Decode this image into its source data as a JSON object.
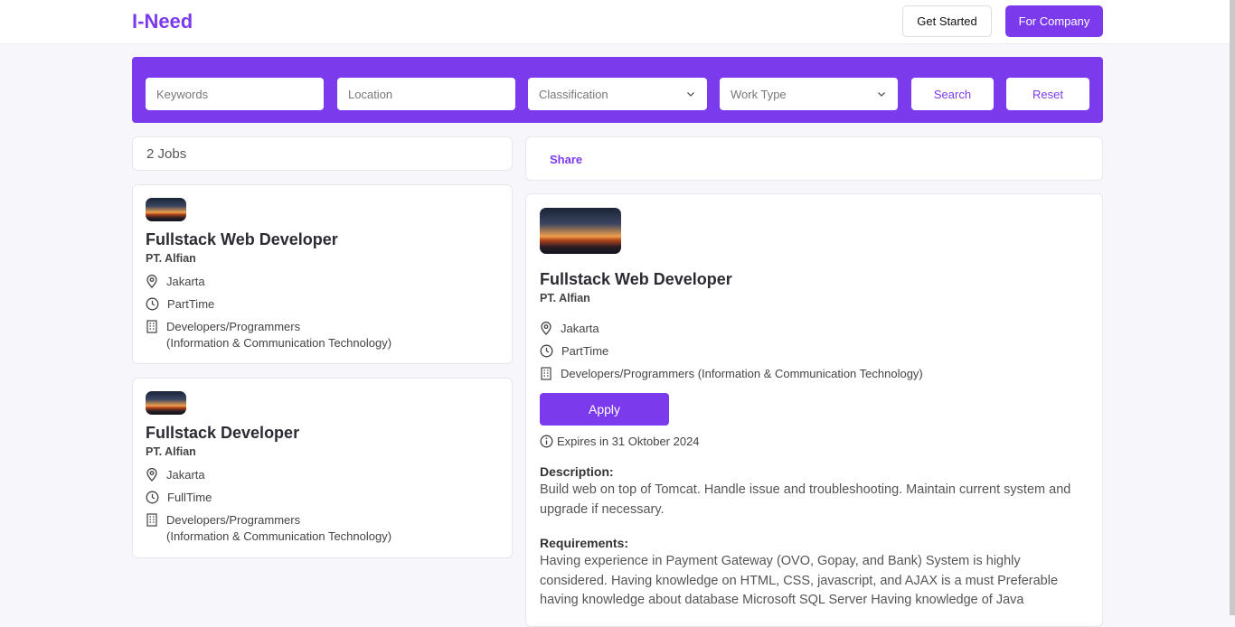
{
  "header": {
    "logo": "I-Need",
    "get_started": "Get Started",
    "for_company": "For Company"
  },
  "search": {
    "keywords_placeholder": "Keywords",
    "location_placeholder": "Location",
    "classification_placeholder": "Classification",
    "worktype_placeholder": "Work Type",
    "search_label": "Search",
    "reset_label": "Reset"
  },
  "list": {
    "count": "2 Jobs",
    "jobs": [
      {
        "title": "Fullstack Web Developer",
        "company": "PT. Alfian",
        "location": "Jakarta",
        "type": "PartTime",
        "classification": "Developers/Programmers",
        "industry": "(Information & Communication Technology)"
      },
      {
        "title": "Fullstack Developer",
        "company": "PT. Alfian",
        "location": "Jakarta",
        "type": "FullTime",
        "classification": "Developers/Programmers",
        "industry": "(Information & Communication Technology)"
      }
    ]
  },
  "detail": {
    "share_label": "Share",
    "title": "Fullstack Web Developer",
    "company": "PT. Alfian",
    "location": "Jakarta",
    "type": "PartTime",
    "classification": "Developers/Programmers (Information & Communication Technology)",
    "apply_label": "Apply",
    "expires": "Expires in 31 Oktober 2024",
    "description_heading": "Description:",
    "description": "Build web on top of Tomcat. Handle issue and troubleshooting. Maintain current system and upgrade if necessary.",
    "requirements_heading": "Requirements:",
    "requirements": "Having experience in Payment Gateway (OVO, Gopay, and Bank) System is highly considered. Having knowledge on HTML, CSS, javascript, and AJAX is a must Preferable having knowledge about database Microsoft SQL Server Having knowledge of Java"
  },
  "colors": {
    "accent": "#7c3aed",
    "background": "#f7f6fb"
  }
}
